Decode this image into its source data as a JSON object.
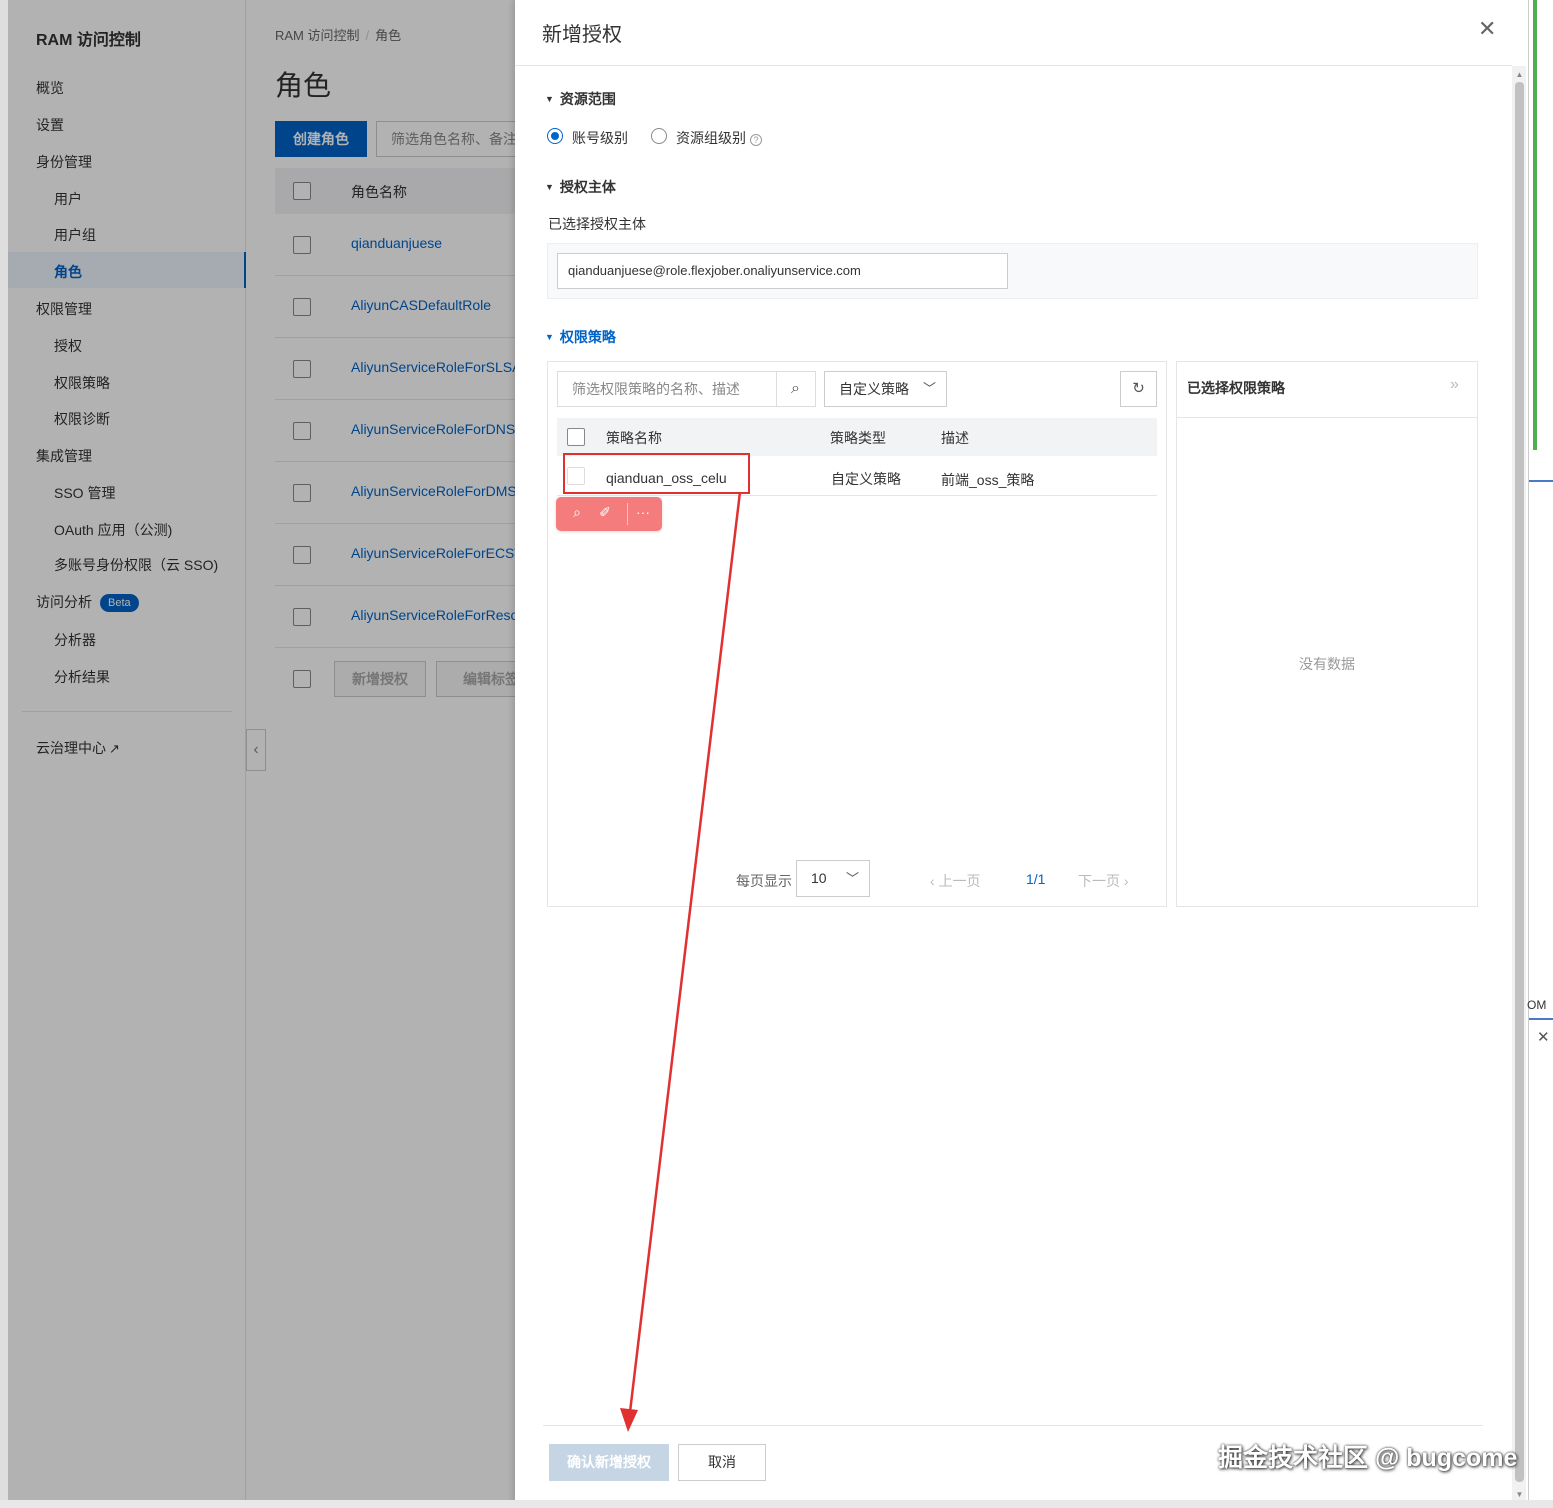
{
  "sidebar": {
    "title": "RAM 访问控制",
    "items": [
      {
        "label": "概览"
      },
      {
        "label": "设置"
      },
      {
        "label": "身份管理"
      },
      {
        "label": "用户"
      },
      {
        "label": "用户组"
      },
      {
        "label": "角色"
      },
      {
        "label": "权限管理"
      },
      {
        "label": "授权"
      },
      {
        "label": "权限策略"
      },
      {
        "label": "权限诊断"
      },
      {
        "label": "集成管理"
      },
      {
        "label": "SSO 管理"
      },
      {
        "label": "OAuth 应用（公测)"
      },
      {
        "label": "多账号身份权限（云 SSO)"
      },
      {
        "label": "访问分析"
      },
      {
        "label": "分析器"
      },
      {
        "label": "分析结果"
      }
    ],
    "beta_badge": "Beta",
    "cloud_governance": "云治理中心",
    "external_icon": "external-link-icon",
    "collapse_icon": "chevron-left-icon"
  },
  "main": {
    "breadcrumb": [
      "RAM 访问控制",
      "角色"
    ],
    "page_title": "角色",
    "create_button": "创建角色",
    "search_placeholder": "筛选角色名称、备注",
    "table_header": "角色名称",
    "roles": [
      "qianduanjuese",
      "AliyunCASDefaultRole",
      "AliyunServiceRoleForSLSAu",
      "AliyunServiceRoleForDNS",
      "AliyunServiceRoleForDMS",
      "AliyunServiceRoleForECSW",
      "AliyunServiceRoleForResou"
    ],
    "footer_buttons": [
      "新增授权",
      "编辑标签"
    ]
  },
  "drawer": {
    "title": "新增授权",
    "close_icon": "close-icon",
    "resource_scope": {
      "label": "资源范围",
      "options": [
        "账号级别",
        "资源组级别"
      ],
      "selected": "账号级别",
      "help_icon": "question-circle-icon"
    },
    "principal": {
      "label": "授权主体",
      "selected_label": "已选择授权主体",
      "value": "qianduanjuese@role.flexjober.onaliyunservice.com"
    },
    "policies": {
      "label": "权限策略",
      "search_placeholder": "筛选权限策略的名称、描述",
      "search_icon": "search-icon",
      "type_filter": "自定义策略",
      "refresh_icon": "refresh-icon",
      "columns": [
        "策略名称",
        "策略类型",
        "描述"
      ],
      "rows": [
        {
          "name": "qianduan_oss_celu",
          "type": "自定义策略",
          "desc": "前端_oss_策略"
        }
      ],
      "pagination": {
        "page_size_label": "每页显示",
        "page_size": "10",
        "prev": "上一页",
        "page": "1/1",
        "next": "下一页"
      }
    },
    "selected_policies": {
      "title": "已选择权限策略",
      "expand_icon": "double-chevron-right-icon",
      "empty_text": "没有数据"
    },
    "confirm_button": "确认新增授权",
    "cancel_button": "取消"
  },
  "hover_toolbar": {
    "icons": [
      "search-icon",
      "magic-wand-icon",
      "more-icon"
    ]
  },
  "right_edge": {
    "text": "OM"
  },
  "watermark": "掘金技术社区 @ bugcome",
  "colors": {
    "primary": "#0064c8",
    "annotation_red": "#e03030",
    "confirm_disabled": "#c6d5e4"
  }
}
